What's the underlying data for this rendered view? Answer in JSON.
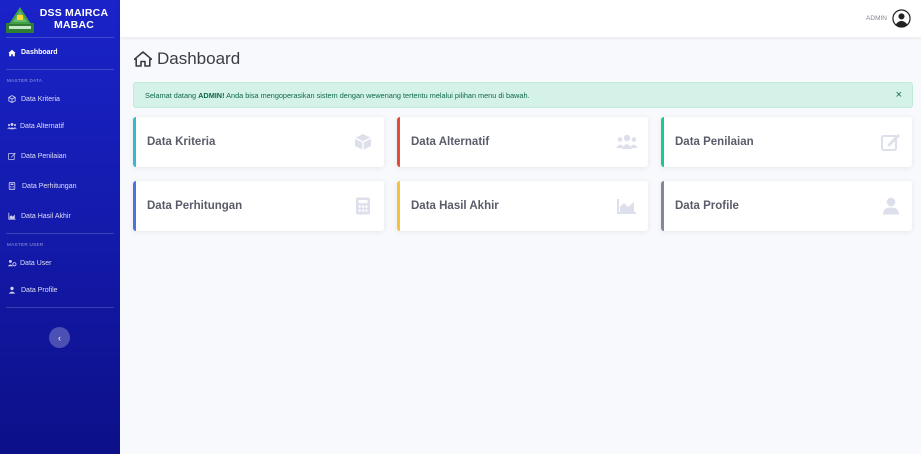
{
  "sidebar": {
    "brand_line1": "DSS MAIRCA",
    "brand_line2": "MABAC",
    "dashboard_label": "Dashboard",
    "section_master_data": "MASTER DATA",
    "items_master_data": [
      {
        "label": "Data Kriteria",
        "icon": "cube-icon"
      },
      {
        "label": "Data Alternatif",
        "icon": "users-icon"
      },
      {
        "label": "Data Penilaian",
        "icon": "edit-icon"
      },
      {
        "label": "Data Perhitungan",
        "icon": "calculator-icon"
      },
      {
        "label": "Data Hasil Akhir",
        "icon": "chart-area-icon"
      }
    ],
    "section_master_user": "MASTER USER",
    "items_master_user": [
      {
        "label": "Data User",
        "icon": "users-cog-icon"
      },
      {
        "label": "Data Profile",
        "icon": "user-icon"
      }
    ],
    "toggle_glyph": "‹"
  },
  "topbar": {
    "user_name": "ADMIN"
  },
  "page": {
    "title": "Dashboard",
    "alert": {
      "prefix": "Selamat datang ",
      "bold": "ADMIN!",
      "suffix": " Anda bisa mengoperasikan sistem dengan wewenang tertentu melalui pilihan menu di bawah.",
      "close": "×"
    },
    "cards": [
      {
        "label": "Data Kriteria",
        "icon": "cube-icon",
        "color": "#36b9cc"
      },
      {
        "label": "Data Alternatif",
        "icon": "users-icon",
        "color": "#e74a3b"
      },
      {
        "label": "Data Penilaian",
        "icon": "edit-icon",
        "color": "#1cc88a"
      },
      {
        "label": "Data Perhitungan",
        "icon": "calculator-icon",
        "color": "#4e73df"
      },
      {
        "label": "Data Hasil Akhir",
        "icon": "chart-area-icon",
        "color": "#f6c23e"
      },
      {
        "label": "Data Profile",
        "icon": "user-icon",
        "color": "#858796"
      }
    ]
  },
  "colors": {
    "sidebar_top": "#1a23c9",
    "sidebar_bottom": "#0c1088",
    "alert_bg": "#d4f2e7",
    "alert_text": "#0f6848"
  }
}
